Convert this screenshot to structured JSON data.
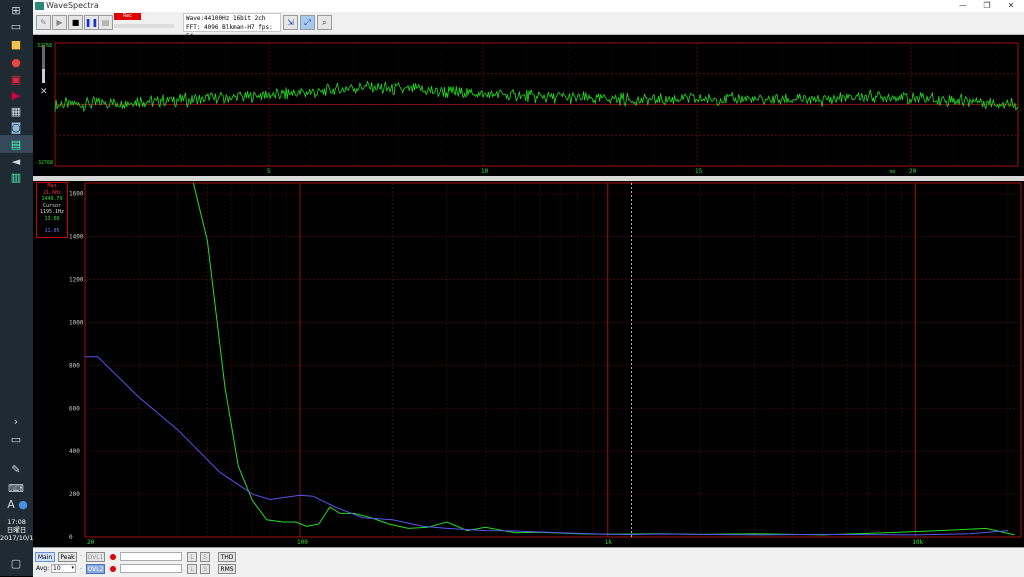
{
  "window": {
    "title": "WaveSpectra",
    "minimize": "—",
    "maximize": "❐",
    "close": "✕"
  },
  "toolbar": {
    "badge": "Rec",
    "info_line1": "Wave:44100Hz 16bit 2ch",
    "info_line2": "FFT: 4096 Blkman-H7  fps: 54"
  },
  "taskbar": {
    "time": "17:08",
    "day": "日曜日",
    "date": "2017/10/15"
  },
  "wave_panel": {
    "y_top": "32768",
    "y_bottom": "-32768",
    "x_ticks": [
      "5",
      "10",
      "15",
      "20"
    ],
    "x_unit": "ms",
    "level_close": "✕"
  },
  "spectrum_panel": {
    "x_unit_label": "Hz",
    "info": {
      "max_label": "Max",
      "max_freq": "21.6Hz",
      "max_val": "1449.79",
      "cursor_label": "Cursor",
      "cursor_freq": "1195.1Hz",
      "cursor_val_green": "13.00",
      "cursor_val_blue": "11.05"
    }
  },
  "bottom": {
    "main": "Main",
    "peak": "Peak",
    "avg_label": "Avg:",
    "avg_value": "10",
    "ovl1": "OVL1",
    "ovl2": "OVL2",
    "l": "L",
    "s": "S",
    "thd": "THD",
    "rms": "RMS"
  },
  "chart_data": [
    {
      "type": "line",
      "title": "",
      "xlabel": "ms",
      "ylabel": "",
      "xlim": [
        0,
        22.5
      ],
      "ylim": [
        -32768,
        32768
      ],
      "yticks": [
        32768,
        -32768
      ],
      "xticks": [
        5,
        10,
        15,
        20
      ],
      "grid": true,
      "series": [
        {
          "color": "#22dd22",
          "x": [
            0,
            2,
            4,
            6,
            7,
            8,
            9,
            10,
            12,
            14,
            16,
            18,
            19,
            20,
            21,
            22.5
          ],
          "y": [
            0,
            1500,
            3500,
            6500,
            9000,
            8500,
            7000,
            5500,
            3500,
            2500,
            3000,
            2500,
            4500,
            3500,
            2500,
            0
          ]
        }
      ]
    },
    {
      "type": "line",
      "title": "",
      "xlabel": "Hz",
      "ylabel": "",
      "xscale": "log",
      "xlim": [
        20,
        22050
      ],
      "ylim": [
        0,
        1650
      ],
      "yticks": [
        0,
        200,
        400,
        600,
        800,
        1000,
        1200,
        1400,
        1600
      ],
      "xtick_labels": [
        "20",
        "100",
        "1k",
        "10k"
      ],
      "cursor_x": 1195.1,
      "grid": true,
      "series": [
        {
          "color": "#22dd22",
          "x": [
            45,
            50,
            57,
            63,
            70,
            78,
            88,
            97,
            105,
            115,
            125,
            135,
            150,
            170,
            195,
            225,
            260,
            300,
            350,
            400,
            500,
            600,
            800,
            1000,
            1500,
            2000,
            3000,
            5000,
            8000,
            12000,
            17000,
            21000
          ],
          "y": [
            1650,
            1380,
            700,
            330,
            170,
            80,
            70,
            70,
            50,
            60,
            140,
            110,
            110,
            90,
            60,
            40,
            45,
            70,
            30,
            45,
            20,
            22,
            15,
            13,
            15,
            12,
            15,
            10,
            20,
            30,
            40,
            10
          ]
        },
        {
          "color": "#5555ee",
          "x": [
            20,
            22,
            30,
            40,
            55,
            70,
            80,
            90,
            100,
            110,
            130,
            160,
            200,
            250,
            300,
            400,
            500,
            700,
            1000,
            1195.1,
            1500,
            2000,
            3000,
            5000,
            10000,
            15000,
            20000
          ],
          "y": [
            840,
            840,
            650,
            500,
            300,
            200,
            175,
            185,
            195,
            190,
            140,
            90,
            80,
            50,
            40,
            30,
            28,
            20,
            13,
            11.05,
            14,
            12,
            10,
            12,
            10,
            15,
            30
          ]
        }
      ]
    }
  ]
}
